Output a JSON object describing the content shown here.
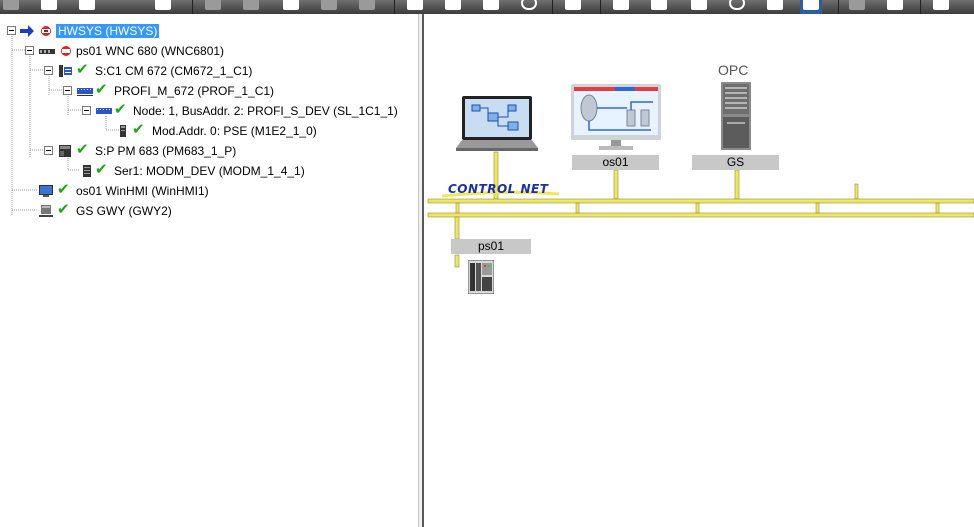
{
  "toolbar": {
    "buttons": [
      {
        "icon": "network-tree-icon"
      },
      {
        "icon": "new-document-icon"
      },
      {
        "icon": "save-icon"
      },
      {
        "icon": "edit-icon"
      },
      {
        "icon": "undo-icon"
      },
      {
        "icon": "cut-icon"
      },
      {
        "icon": "copy-icon"
      },
      {
        "icon": "paste-icon"
      },
      {
        "icon": "print-icon"
      },
      {
        "icon": "verify-icon"
      },
      {
        "icon": "download-icon"
      },
      {
        "icon": "online-icon"
      },
      {
        "icon": "hardware-icon"
      },
      {
        "icon": "controller-icon"
      },
      {
        "icon": "wireless-icon"
      },
      {
        "icon": "printer-icon"
      },
      {
        "icon": "info-icon"
      },
      {
        "icon": "report-icon"
      },
      {
        "icon": "lightbulb-icon"
      },
      {
        "icon": "move-right-icon"
      },
      {
        "icon": "arrows-icon"
      },
      {
        "icon": "exit-icon"
      }
    ]
  },
  "tree": {
    "items": [
      {
        "label": "HWSYS (HWSYS)",
        "icon": "system-icon",
        "selected": true
      },
      {
        "label": "ps01   WNC 680 (WNC6801)",
        "icon": "controller-station-icon"
      },
      {
        "label": "S:C1 CM 672 (CM672_1_C1)",
        "icon": "communication-module-icon"
      },
      {
        "label": "PROFI_M_672 (PROF_1_C1)",
        "icon": "profibus-master-icon"
      },
      {
        "label": "Node: 1, BusAddr. 2: PROFI_S_DEV (SL_1C1_1)",
        "icon": "profibus-slave-icon"
      },
      {
        "label": "Mod.Addr. 0: PSE (M1E2_1_0)",
        "icon": "io-module-icon"
      },
      {
        "label": "S:P PM 683 (PM683_1_P)",
        "icon": "processor-module-icon"
      },
      {
        "label": "Ser1: MODM_DEV (MODM_1_4_1)",
        "icon": "serial-device-icon"
      },
      {
        "label": "os01  WinHMI (WinHMI1)",
        "icon": "hmi-monitor-icon"
      },
      {
        "label": "GS  GWY (GWY2)",
        "icon": "gateway-icon"
      }
    ]
  },
  "diagram": {
    "network_name": "CONTROL NET",
    "opc_label": "OPC",
    "devices": [
      {
        "label": "os01",
        "icon": "hmi-monitor-icon"
      },
      {
        "label": "GS",
        "icon": "opc-server-icon"
      },
      {
        "label": "ps01",
        "icon": "controller-rack-icon"
      }
    ],
    "bus_color": "#f0e85a",
    "engineering_icon": "engineering-laptop-icon"
  },
  "colors": {
    "selection": "#3399ff",
    "check": "#1ea51e",
    "network_text": "#1a2fa8"
  }
}
